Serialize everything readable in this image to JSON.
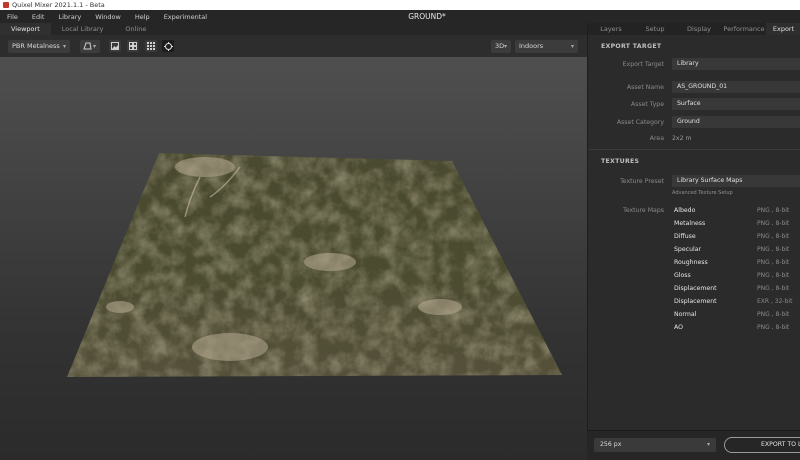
{
  "window": {
    "title": "Quixel Mixer 2021.1.1 - Beta"
  },
  "menu": [
    "File",
    "Edit",
    "Library",
    "Window",
    "Help",
    "Experimental"
  ],
  "document_title": "GROUND*",
  "left_tabs": [
    "Viewport",
    "Local Library",
    "Online"
  ],
  "toolbar": {
    "material_mode": "PBR Metalness",
    "view_mode": "3D",
    "environment": "Indoors"
  },
  "right_tabs": [
    "Layers",
    "Setup",
    "Display",
    "Performance",
    "Export"
  ],
  "export_target": {
    "heading": "EXPORT TARGET",
    "target_label": "Export Target",
    "target_value": "Library",
    "asset_name_label": "Asset Name",
    "asset_name_value": "AS_GROUND_01",
    "asset_type_label": "Asset Type",
    "asset_type_value": "Surface",
    "asset_category_label": "Asset Category",
    "asset_category_value": "Ground",
    "area_label": "Area",
    "area_value": "2x2 m"
  },
  "textures": {
    "heading": "TEXTURES",
    "preset_label": "Texture Preset",
    "preset_value": "Library Surface Maps",
    "advanced_link": "Advanced Texture Setup",
    "maps_label": "Texture Maps",
    "maps": [
      {
        "name": "Albedo",
        "format": "PNG , 8-bit"
      },
      {
        "name": "Metalness",
        "format": "PNG , 8-bit"
      },
      {
        "name": "Diffuse",
        "format": "PNG , 8-bit"
      },
      {
        "name": "Specular",
        "format": "PNG , 8-bit"
      },
      {
        "name": "Roughness",
        "format": "PNG , 8-bit"
      },
      {
        "name": "Gloss",
        "format": "PNG , 8-bit"
      },
      {
        "name": "Displacement",
        "format": "PNG , 8-bit"
      },
      {
        "name": "Displacement",
        "format": "EXR , 32-bit"
      },
      {
        "name": "Normal",
        "format": "PNG , 8-bit"
      },
      {
        "name": "AO",
        "format": "PNG , 8-bit"
      }
    ]
  },
  "footer": {
    "resolution": "256 px",
    "export_button": "EXPORT TO LIBR"
  }
}
